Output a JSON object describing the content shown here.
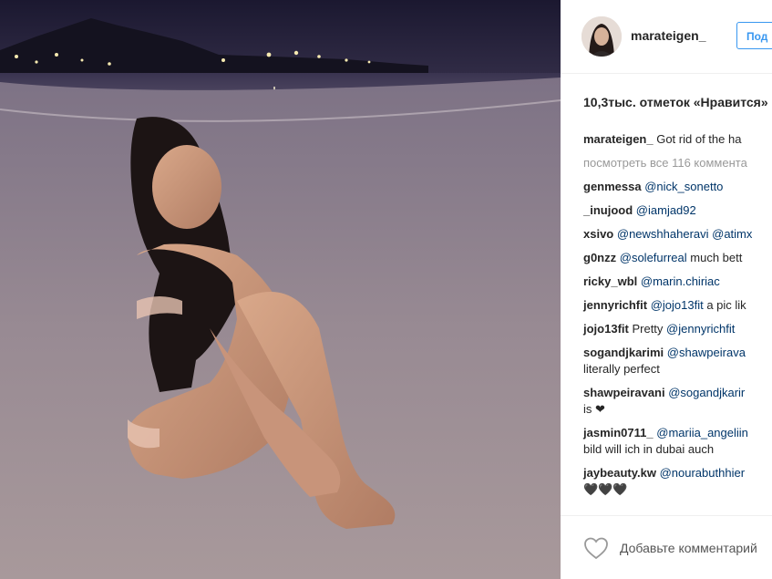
{
  "post": {
    "username": "marateigen_",
    "follow_label": "Под",
    "likes": "10,3тыс. отметок «Нравится»",
    "caption_user": "marateigen_",
    "caption_text": "Got rid of the ha",
    "view_all": "посмотреть все 116 коммента",
    "add_comment_placeholder": "Добавьте комментарий"
  },
  "comments": [
    {
      "user": "genmessa",
      "mention": "@nick_sonetto",
      "text": "",
      "line2": ""
    },
    {
      "user": "_inujood",
      "mention": "@iamjad92",
      "text": "",
      "line2": ""
    },
    {
      "user": "xsivo",
      "mention": "@newshhaheravi @atimx",
      "text": "",
      "line2": ""
    },
    {
      "user": "g0nzz",
      "mention": "@solefurreal",
      "text": " much bett",
      "line2": ""
    },
    {
      "user": "ricky_wbl",
      "mention": "@marin.chiriac",
      "text": "",
      "line2": ""
    },
    {
      "user": "jennyrichfit",
      "mention": "@jojo13fit",
      "text": " a pic lik",
      "line2": ""
    },
    {
      "user": "jojo13fit",
      "mention": "",
      "text": "Pretty ",
      "mention2": "@jennyrichfit",
      "line2": ""
    },
    {
      "user": "sogandjkarimi",
      "mention": "@shawpeirava",
      "text": "",
      "line2": "literally perfect"
    },
    {
      "user": "shawpeiravani",
      "mention": "@sogandjkarir",
      "text": "",
      "line2": "is ❤"
    },
    {
      "user": "jasmin0711_",
      "mention": "@mariia_angeliin",
      "text": "",
      "line2": "bild will ich in dubai auch"
    },
    {
      "user": "jaybeauty.kw",
      "mention": "@nourabuthhier",
      "text": "",
      "line2": "🖤🖤🖤"
    }
  ],
  "colors": {
    "accent": "#3897f0",
    "mention": "#003569",
    "muted": "#999999",
    "text": "#262626"
  },
  "icons": {
    "like": "heart-icon"
  }
}
